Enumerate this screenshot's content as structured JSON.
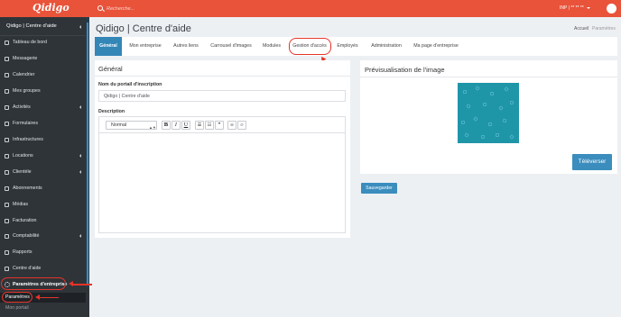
{
  "app": {
    "logo": "Qidigo"
  },
  "topbar": {
    "search_placeholder": "Recherche...",
    "user_label": "INP | ** ** **"
  },
  "sidebar": {
    "org_name": "Qidigo | Centre d'aide",
    "items": [
      {
        "label": "Tableau de bord",
        "icon": "speedometer-icon"
      },
      {
        "label": "Messagerie",
        "icon": "envelope-icon"
      },
      {
        "label": "Calendrier",
        "icon": "calendar-icon"
      },
      {
        "label": "Mes groupes",
        "icon": "folder-icon"
      },
      {
        "label": "Activités",
        "icon": "gear-icon"
      },
      {
        "label": "Formulaires",
        "icon": "document-icon"
      },
      {
        "label": "Infrastructures",
        "icon": "building-icon"
      },
      {
        "label": "Locations",
        "icon": "calendar-icon"
      },
      {
        "label": "Clientèle",
        "icon": "users-icon"
      },
      {
        "label": "Abonnements",
        "icon": "card-icon"
      },
      {
        "label": "Médias",
        "icon": "image-icon"
      },
      {
        "label": "Facturation",
        "icon": "invoice-icon"
      },
      {
        "label": "Comptabilité",
        "icon": "calculator-icon"
      },
      {
        "label": "Rapports",
        "icon": "chart-icon"
      },
      {
        "label": "Centre d'aide",
        "icon": "help-icon"
      }
    ],
    "settings": {
      "label": "Paramètres d'entreprise",
      "icon": "gear-icon"
    },
    "sub_active": "Paramètres",
    "sub_next": "Mon portail"
  },
  "header": {
    "title": "Qidigo | Centre d'aide",
    "breadcrumb_home": "Accueil",
    "breadcrumb_sep": "/",
    "breadcrumb_current": "Paramètres"
  },
  "tabs": [
    {
      "label": "Général",
      "active": true
    },
    {
      "label": "Mon entreprise"
    },
    {
      "label": "Autres liens"
    },
    {
      "label": "Carrousel d'images"
    },
    {
      "label": "Modules"
    },
    {
      "label": "Gestion d'accès",
      "highlighted": true
    },
    {
      "label": "Employés"
    },
    {
      "label": "Administration"
    },
    {
      "label": "Ma page d'entreprise"
    }
  ],
  "general": {
    "heading": "Général",
    "portal_name_label": "Nom du portail d'inscription",
    "portal_name_value": "Qidigo | Centre d'aide",
    "description_label": "Description",
    "format_value": "Normal",
    "toolbar": {
      "bold": "B",
      "italic": "I",
      "underline": "U",
      "quote": "”"
    }
  },
  "preview": {
    "heading": "Prévisualisation de l'image",
    "upload_label": "Téléverser"
  },
  "actions": {
    "save_label": "Sauvegarder"
  },
  "colors": {
    "brand": "#e8533a",
    "primary": "#3486b7",
    "annotation": "#e5342a",
    "sidebar": "#2f3439"
  }
}
